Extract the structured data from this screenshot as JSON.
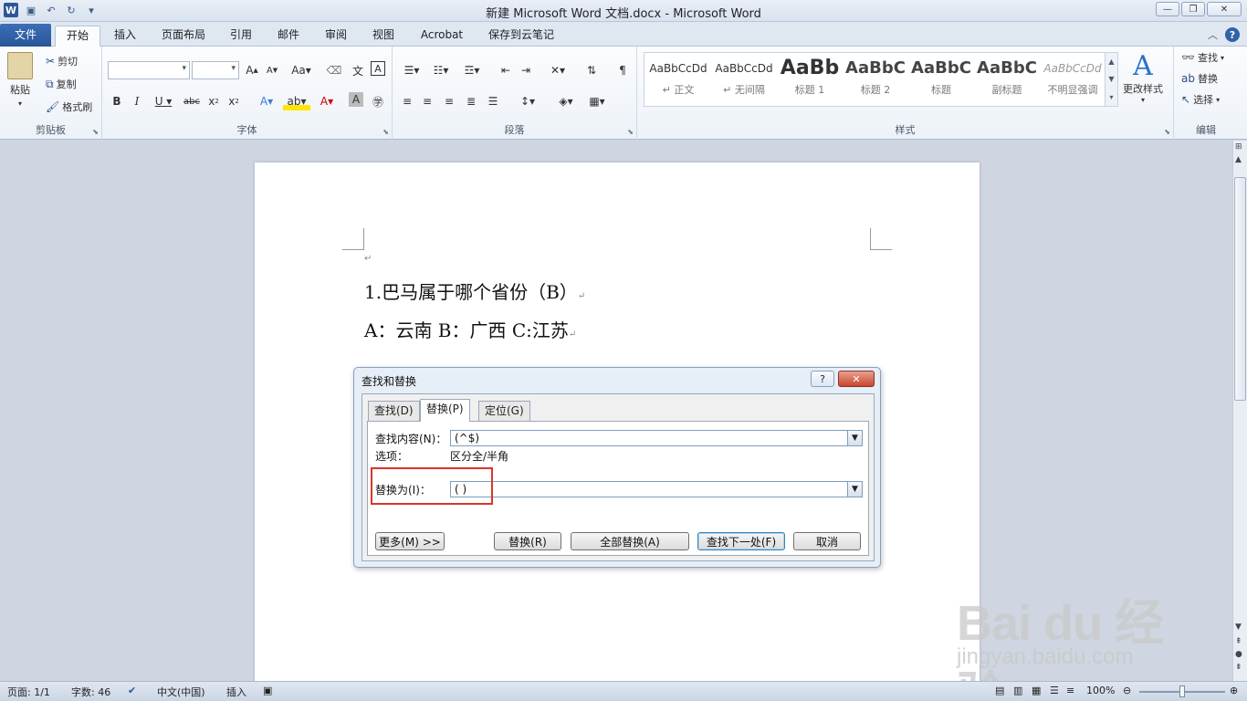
{
  "window": {
    "title": "新建 Microsoft Word 文档.docx  -  Microsoft Word",
    "quick_access": [
      "save-icon",
      "undo-icon",
      "redo-icon"
    ],
    "controls": [
      "—",
      "❐",
      "✕"
    ]
  },
  "tabs": {
    "file": "文件",
    "items": [
      "开始",
      "插入",
      "页面布局",
      "引用",
      "邮件",
      "审阅",
      "视图",
      "Acrobat",
      "保存到云笔记"
    ],
    "active_index": 0
  },
  "ribbon": {
    "clipboard": {
      "label": "剪贴板",
      "paste": "粘贴",
      "cut": "剪切",
      "copy": "复制",
      "format_painter": "格式刷"
    },
    "font": {
      "label": "字体"
    },
    "paragraph": {
      "label": "段落"
    },
    "styles": {
      "label": "样式",
      "items": [
        {
          "sample": "AaBbCcDd",
          "name": "↵ 正文"
        },
        {
          "sample": "AaBbCcDd",
          "name": "↵ 无间隔"
        },
        {
          "sample": "AaBb",
          "name": "标题 1"
        },
        {
          "sample": "AaBbC",
          "name": "标题 2"
        },
        {
          "sample": "AaBbC",
          "name": "标题"
        },
        {
          "sample": "AaBbC",
          "name": "副标题"
        },
        {
          "sample": "AaBbCcDd",
          "name": "不明显强调"
        }
      ],
      "change_styles": "更改样式"
    },
    "editing": {
      "label": "编辑",
      "find": "查找",
      "replace": "替换",
      "select": "选择"
    }
  },
  "document": {
    "lines": [
      "1.巴马属于哪个省份（B）",
      "A：云南 B：广西 C:江苏"
    ]
  },
  "dialog": {
    "title": "查找和替换",
    "help": "?",
    "close": "✕",
    "tabs": [
      "查找(D)",
      "替换(P)",
      "定位(G)"
    ],
    "find_label": "查找内容(N)：",
    "find_value": "(^$)",
    "options_label": "选项：",
    "options_value": "区分全/半角",
    "replace_label": "替换为(I)：",
    "replace_value": "( )",
    "buttons": {
      "more": "更多(M) >>",
      "replace": "替换(R)",
      "replace_all": "全部替换(A)",
      "find_next": "查找下一处(F)",
      "cancel": "取消"
    }
  },
  "status": {
    "page": "页面: 1/1",
    "words": "字数: 46",
    "language": "中文(中国)",
    "mode": "插入",
    "zoom": "100%"
  },
  "watermark": {
    "logo": "Bai du 经验",
    "site": "jingyan.baidu.com"
  }
}
